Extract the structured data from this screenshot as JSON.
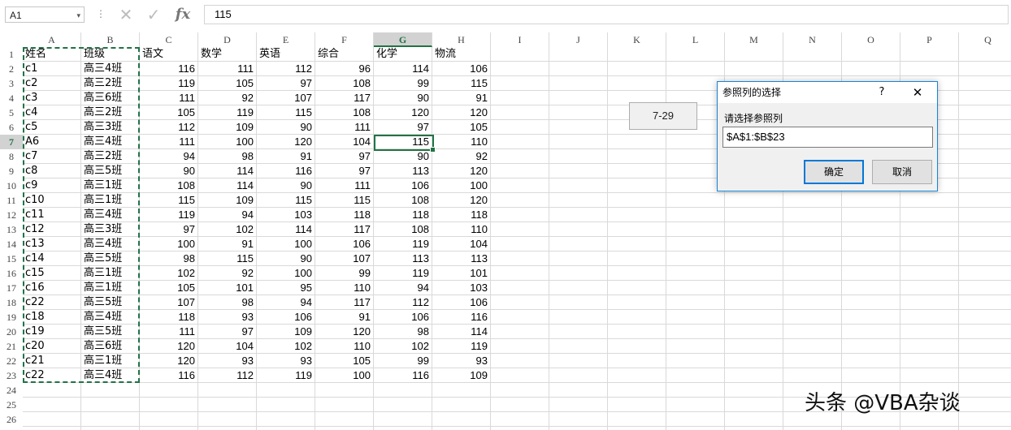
{
  "formula_bar": {
    "name_box": "A1",
    "name_box_caret": "▾",
    "separator": "⋮",
    "cancel_glyph": "✕",
    "enter_glyph": "✓",
    "fx_glyph": "fx",
    "formula_value": "115"
  },
  "columns": [
    "A",
    "B",
    "C",
    "D",
    "E",
    "F",
    "G",
    "H",
    "I",
    "J",
    "K",
    "L",
    "M",
    "N",
    "O",
    "P",
    "Q"
  ],
  "active_column": "G",
  "active_row": 7,
  "row_numbers": [
    "1",
    "2",
    "3",
    "4",
    "5",
    "6",
    "7",
    "8",
    "9",
    "10",
    "11",
    "12",
    "13",
    "14",
    "15",
    "16",
    "17",
    "18",
    "19",
    "20",
    "21",
    "22",
    "23",
    "24",
    "25",
    "26"
  ],
  "table": {
    "headers": [
      "姓名",
      "班级",
      "语文",
      "数学",
      "英语",
      "综合",
      "化学",
      "物流"
    ],
    "rows": [
      [
        "c1",
        "高三4班",
        "116",
        "111",
        "112",
        "96",
        "114",
        "106"
      ],
      [
        "c2",
        "高三2班",
        "119",
        "105",
        "97",
        "108",
        "99",
        "115"
      ],
      [
        "c3",
        "高三6班",
        "111",
        "92",
        "107",
        "117",
        "90",
        "91"
      ],
      [
        "c4",
        "高三2班",
        "105",
        "119",
        "115",
        "108",
        "120",
        "120"
      ],
      [
        "c5",
        "高三3班",
        "112",
        "109",
        "90",
        "111",
        "97",
        "105"
      ],
      [
        "A6",
        "高三4班",
        "111",
        "100",
        "120",
        "104",
        "115",
        "110"
      ],
      [
        "c7",
        "高三2班",
        "94",
        "98",
        "91",
        "97",
        "90",
        "92"
      ],
      [
        "c8",
        "高三5班",
        "90",
        "114",
        "116",
        "97",
        "113",
        "120"
      ],
      [
        "c9",
        "高三1班",
        "108",
        "114",
        "90",
        "111",
        "106",
        "100"
      ],
      [
        "c10",
        "高三1班",
        "115",
        "109",
        "115",
        "115",
        "108",
        "120"
      ],
      [
        "c11",
        "高三4班",
        "119",
        "94",
        "103",
        "118",
        "118",
        "118"
      ],
      [
        "c12",
        "高三3班",
        "97",
        "102",
        "114",
        "117",
        "108",
        "110"
      ],
      [
        "c13",
        "高三4班",
        "100",
        "91",
        "100",
        "106",
        "119",
        "104"
      ],
      [
        "c14",
        "高三5班",
        "98",
        "115",
        "90",
        "107",
        "113",
        "113"
      ],
      [
        "c15",
        "高三1班",
        "102",
        "92",
        "100",
        "99",
        "119",
        "101"
      ],
      [
        "c16",
        "高三1班",
        "105",
        "101",
        "95",
        "110",
        "94",
        "103"
      ],
      [
        "c22",
        "高三5班",
        "107",
        "98",
        "94",
        "117",
        "112",
        "106"
      ],
      [
        "c18",
        "高三4班",
        "118",
        "93",
        "106",
        "91",
        "106",
        "116"
      ],
      [
        "c19",
        "高三5班",
        "111",
        "97",
        "109",
        "120",
        "98",
        "114"
      ],
      [
        "c20",
        "高三6班",
        "120",
        "104",
        "102",
        "110",
        "102",
        "119"
      ],
      [
        "c21",
        "高三1班",
        "120",
        "93",
        "93",
        "105",
        "99",
        "93"
      ],
      [
        "c22",
        "高三4班",
        "116",
        "112",
        "119",
        "100",
        "116",
        "109"
      ]
    ]
  },
  "sheet_button": {
    "label": "7-29"
  },
  "dialog": {
    "title": "参照列的选择",
    "help": "?",
    "close": "✕",
    "prompt": "请选择参照列",
    "input_value": "$A$1:$B$23",
    "ok_label": "确定",
    "cancel_label": "取消"
  },
  "watermark": "头条 @VBA杂谈",
  "colors": {
    "accent": "#217346",
    "dialog_border": "#1883d7"
  }
}
